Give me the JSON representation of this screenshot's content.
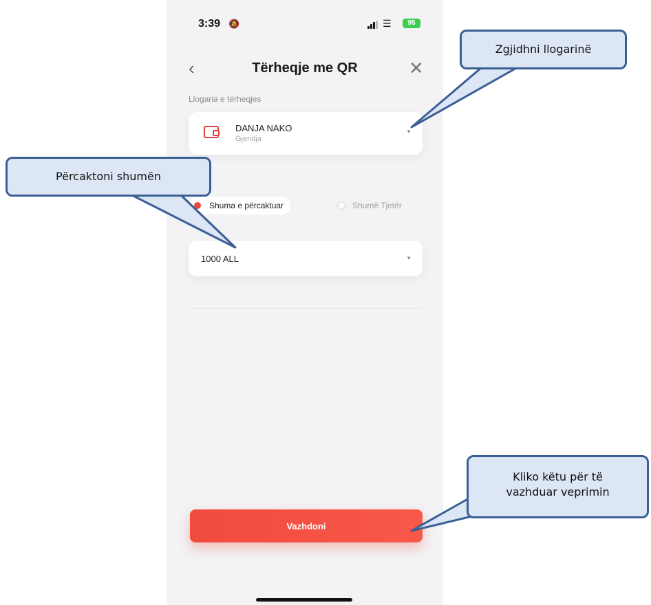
{
  "status_bar": {
    "time": "3:39",
    "battery": "95"
  },
  "header": {
    "title": "Tërheqje me QR",
    "back_icon": "chevron-left-icon",
    "close_icon": "close-icon"
  },
  "account": {
    "section_label": "Llogaria e tërheqjes",
    "name": "DANJA NAKO",
    "subtitle": "Gjendja"
  },
  "amount_type": {
    "selected": "Shuma e përcaktuar",
    "other": "Shumë Tjetër"
  },
  "amount": {
    "value": "1000 ALL"
  },
  "actions": {
    "continue_label": "Vazhdoni"
  },
  "callouts": {
    "select_account": "Zgjidhni llogarinë",
    "set_amount": "Përcaktoni shumën",
    "continue_line1": "Kliko këtu për të",
    "continue_line2": "vazhduar veprimin"
  },
  "colors": {
    "accent": "#f04b3e",
    "callout_fill": "#dce6f4",
    "callout_border": "#3b5e94"
  }
}
